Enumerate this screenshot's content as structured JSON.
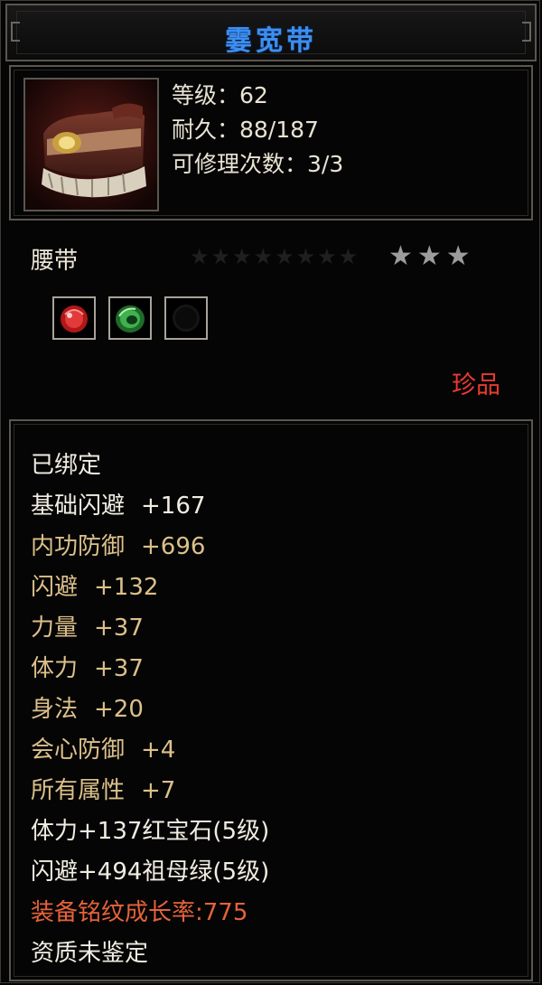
{
  "item": {
    "name": "霎宽带",
    "level_line": "等级：62",
    "durability_line": "耐久：88/187",
    "repair_line": "可修理次数：3/3",
    "type": "腰带",
    "rarity": "珍品",
    "star_rating": 3,
    "stars_text": "★★★",
    "faint_stars_text": "★★★★★★★★",
    "title_color": "#3c8ff0",
    "rarity_color": "#ea3a2f"
  },
  "gem_slots": [
    {
      "name": "ruby",
      "filled": true
    },
    {
      "name": "emerald",
      "filled": true
    },
    {
      "name": "empty",
      "filled": false
    }
  ],
  "attributes": {
    "bound": "已绑定",
    "base_dodge": {
      "label": "基础闪避",
      "value": "+167"
    },
    "inner_defense": {
      "label": "内功防御",
      "value": "+696"
    },
    "dodge": {
      "label": "闪避",
      "value": "+132"
    },
    "strength": {
      "label": "力量",
      "value": "+37"
    },
    "stamina": {
      "label": "体力",
      "value": "+37"
    },
    "agility": {
      "label": "身法",
      "value": "+20"
    },
    "crit_defense": {
      "label": "会心防御",
      "value": "+4"
    },
    "all_attributes": {
      "label": "所有属性",
      "value": "+7"
    },
    "gem1": "体力+137红宝石(5级)",
    "gem2": "闪避+494祖母绿(5级)",
    "growth": "装备铭纹成长率:775",
    "aptitude": "资质未鉴定"
  }
}
